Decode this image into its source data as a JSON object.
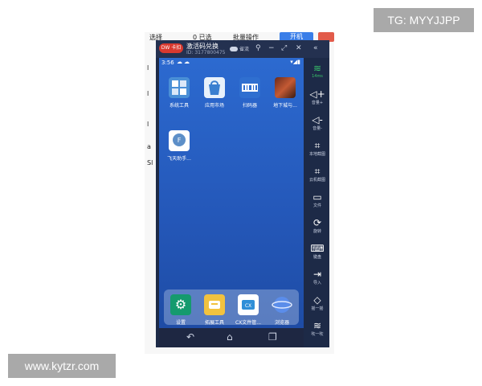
{
  "watermarks": {
    "tg": "TG: MYYJJPP",
    "site": "www.kytzr.com"
  },
  "background_page": {
    "top_items": [
      "选择",
      "0 已选",
      "批量操作"
    ],
    "start_button": "开机",
    "side_fragments": [
      "l",
      "l",
      "l",
      "a",
      "Sl"
    ]
  },
  "emulator": {
    "title": "激活码兑换",
    "id": "ID: 3177800475",
    "logo": "DW 卡扣",
    "titlebar_toggle": "省流",
    "status": {
      "time": "3:56"
    },
    "apps": [
      {
        "label": "系统工具",
        "icon": "tools-icon",
        "color": "#4a8fd6"
      },
      {
        "label": "应用市场",
        "icon": "store-icon",
        "color": "#3a7fd0"
      },
      {
        "label": "扫码器",
        "icon": "scanner-icon",
        "color": "#2f6fd0"
      },
      {
        "label": "地下城与...",
        "icon": "game-icon",
        "color": "#b2432c"
      },
      {
        "label": "飞天助手...",
        "icon": "assistant-icon",
        "color": "#5d8fc8"
      }
    ],
    "dock": [
      {
        "label": "设置",
        "icon": "settings-icon",
        "color": "#159a6e"
      },
      {
        "label": "拓展工具",
        "icon": "extension-tools-icon",
        "color": "#f2c23e"
      },
      {
        "label": "CX文件管...",
        "icon": "file-manager-icon",
        "color": "#2f8fd8"
      },
      {
        "label": "浏览器",
        "icon": "browser-icon",
        "color": "#5b8dea"
      }
    ],
    "sidebar": [
      {
        "label": "14ms",
        "icon": "wifi-icon",
        "glyph": "((•))"
      },
      {
        "label": "音量+",
        "icon": "volume-up-icon",
        "glyph": "◁+"
      },
      {
        "label": "音量-",
        "icon": "volume-down-icon",
        "glyph": "◁-"
      },
      {
        "label": "本地截图",
        "icon": "local-screenshot-icon",
        "glyph": "⌗"
      },
      {
        "label": "云机截图",
        "icon": "cloud-screenshot-icon",
        "glyph": "⌗"
      },
      {
        "label": "文件",
        "icon": "file-icon",
        "glyph": "▭"
      },
      {
        "label": "旋转",
        "icon": "rotate-icon",
        "glyph": "⟳"
      },
      {
        "label": "键盘",
        "icon": "keyboard-icon",
        "glyph": "⌨"
      },
      {
        "label": "导入",
        "icon": "import-icon",
        "glyph": "⇥"
      },
      {
        "label": "摇一摇",
        "icon": "shake-icon",
        "glyph": "◇"
      },
      {
        "label": "吹一吹",
        "icon": "blow-icon",
        "glyph": "≋"
      }
    ]
  }
}
